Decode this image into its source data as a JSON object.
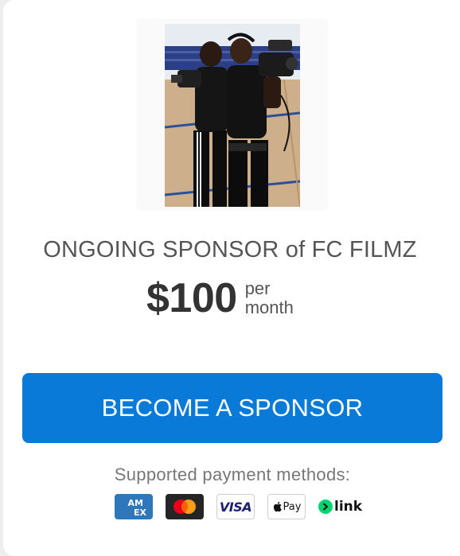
{
  "sponsor_card": {
    "title": "ONGOING SPONSOR of FC FILMZ",
    "price": {
      "amount": "$100",
      "period_line1": "per",
      "period_line2": "month"
    },
    "cta_label": "BECOME A SPONSOR",
    "payment_methods": {
      "label": "Supported payment methods:",
      "items": [
        {
          "name": "amex",
          "text": "AM EX",
          "color": "#2e77bb"
        },
        {
          "name": "mastercard",
          "colors": [
            "#eb001b",
            "#f79e1b"
          ]
        },
        {
          "name": "visa",
          "text": "VISA",
          "color": "#1a1f71"
        },
        {
          "name": "apple-pay",
          "text": "Pay"
        },
        {
          "name": "link",
          "text": "link",
          "color": "#00d66f"
        }
      ]
    }
  },
  "colors": {
    "accent": "#0a7ad9",
    "title_text": "#555555",
    "price_text": "#333333",
    "muted_text": "#777777"
  }
}
